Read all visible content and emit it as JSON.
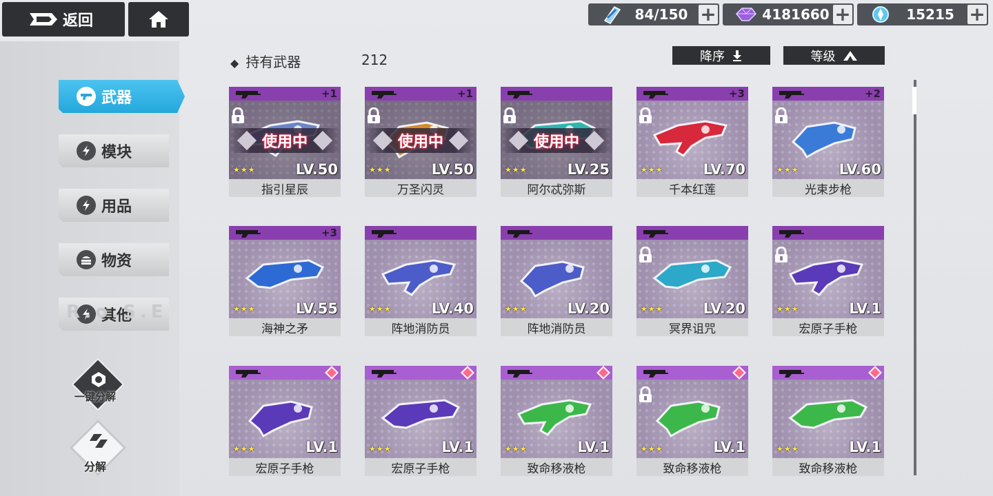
{
  "topbar": {
    "back_label": "返回",
    "resources": [
      {
        "icon": "stamina-crystal-icon",
        "value": "84/150"
      },
      {
        "icon": "purple-gem-icon",
        "value": "4181660"
      },
      {
        "icon": "blue-crystal-icon",
        "value": "15215"
      }
    ],
    "plus_label": "+"
  },
  "sidebar": {
    "items": [
      {
        "label": "武器",
        "icon": "gun-icon",
        "active": true
      },
      {
        "label": "模块",
        "icon": "bolt-icon"
      },
      {
        "label": "用品",
        "icon": "bolt-icon"
      },
      {
        "label": "物资",
        "icon": "supply-icon"
      },
      {
        "label": "其他",
        "icon": "bolt-icon"
      }
    ],
    "watermark": "R.o.S.E",
    "quick_dismantle_label": "一键分解",
    "dismantle_label": "分解"
  },
  "header": {
    "owned_label": "持有武器",
    "owned_count": "212",
    "sort_order_label": "降序",
    "sort_key_label": "等级"
  },
  "in_use_label": "使用中",
  "weapons": [
    {
      "name": "指引星辰",
      "level": "LV.50",
      "stars": "★★★",
      "plus": "+1",
      "locked": true,
      "in_use": true,
      "weapon_color": "#6a86c8"
    },
    {
      "name": "万圣闪灵",
      "level": "LV.50",
      "stars": "★★★",
      "plus": "+1",
      "locked": true,
      "in_use": true,
      "weapon_color": "#d58b2a"
    },
    {
      "name": "阿尔忒弥斯",
      "level": "LV.25",
      "stars": "★★★",
      "plus": "",
      "locked": true,
      "in_use": true,
      "weapon_color": "#2eb6b0"
    },
    {
      "name": "千本红莲",
      "level": "LV.70",
      "stars": "★★★",
      "plus": "+3",
      "locked": true,
      "in_use": false,
      "weapon_color": "#d8283c"
    },
    {
      "name": "光束步枪",
      "level": "LV.60",
      "stars": "★★★",
      "plus": "+2",
      "locked": true,
      "in_use": false,
      "weapon_color": "#3a7bd8"
    },
    {
      "name": "海神之矛",
      "level": "LV.55",
      "stars": "★★★",
      "plus": "+3",
      "locked": false,
      "in_use": false,
      "weapon_color": "#2d6ad4"
    },
    {
      "name": "阵地消防员",
      "level": "LV.40",
      "stars": "★★★",
      "plus": "",
      "locked": false,
      "in_use": false,
      "weapon_color": "#4c5cc8"
    },
    {
      "name": "阵地消防员",
      "level": "LV.20",
      "stars": "★★★",
      "plus": "",
      "locked": false,
      "in_use": false,
      "weapon_color": "#4c5cc8"
    },
    {
      "name": "冥界诅咒",
      "level": "LV.20",
      "stars": "★★★",
      "plus": "",
      "locked": true,
      "in_use": false,
      "weapon_color": "#2ca8c8"
    },
    {
      "name": "宏原子手枪",
      "level": "LV.1",
      "stars": "★★★",
      "plus": "",
      "locked": true,
      "in_use": false,
      "weapon_color": "#5a3ab8"
    },
    {
      "name": "宏原子手枪",
      "level": "LV.1",
      "stars": "★★★",
      "plus": "",
      "locked": false,
      "in_use": false,
      "gem": true,
      "weapon_color": "#5a3ab8"
    },
    {
      "name": "宏原子手枪",
      "level": "LV.1",
      "stars": "★★★",
      "plus": "",
      "locked": false,
      "in_use": false,
      "gem": true,
      "weapon_color": "#5a3ab8"
    },
    {
      "name": "致命移液枪",
      "level": "LV.1",
      "stars": "★★★",
      "plus": "",
      "locked": false,
      "in_use": false,
      "gem": true,
      "weapon_color": "#3cb84a"
    },
    {
      "name": "致命移液枪",
      "level": "LV.1",
      "stars": "★★★",
      "plus": "",
      "locked": true,
      "in_use": false,
      "gem": true,
      "weapon_color": "#3cb84a"
    },
    {
      "name": "致命移液枪",
      "level": "LV.1",
      "stars": "★★★",
      "plus": "",
      "locked": false,
      "in_use": false,
      "gem": true,
      "weapon_color": "#3cb84a"
    }
  ]
}
